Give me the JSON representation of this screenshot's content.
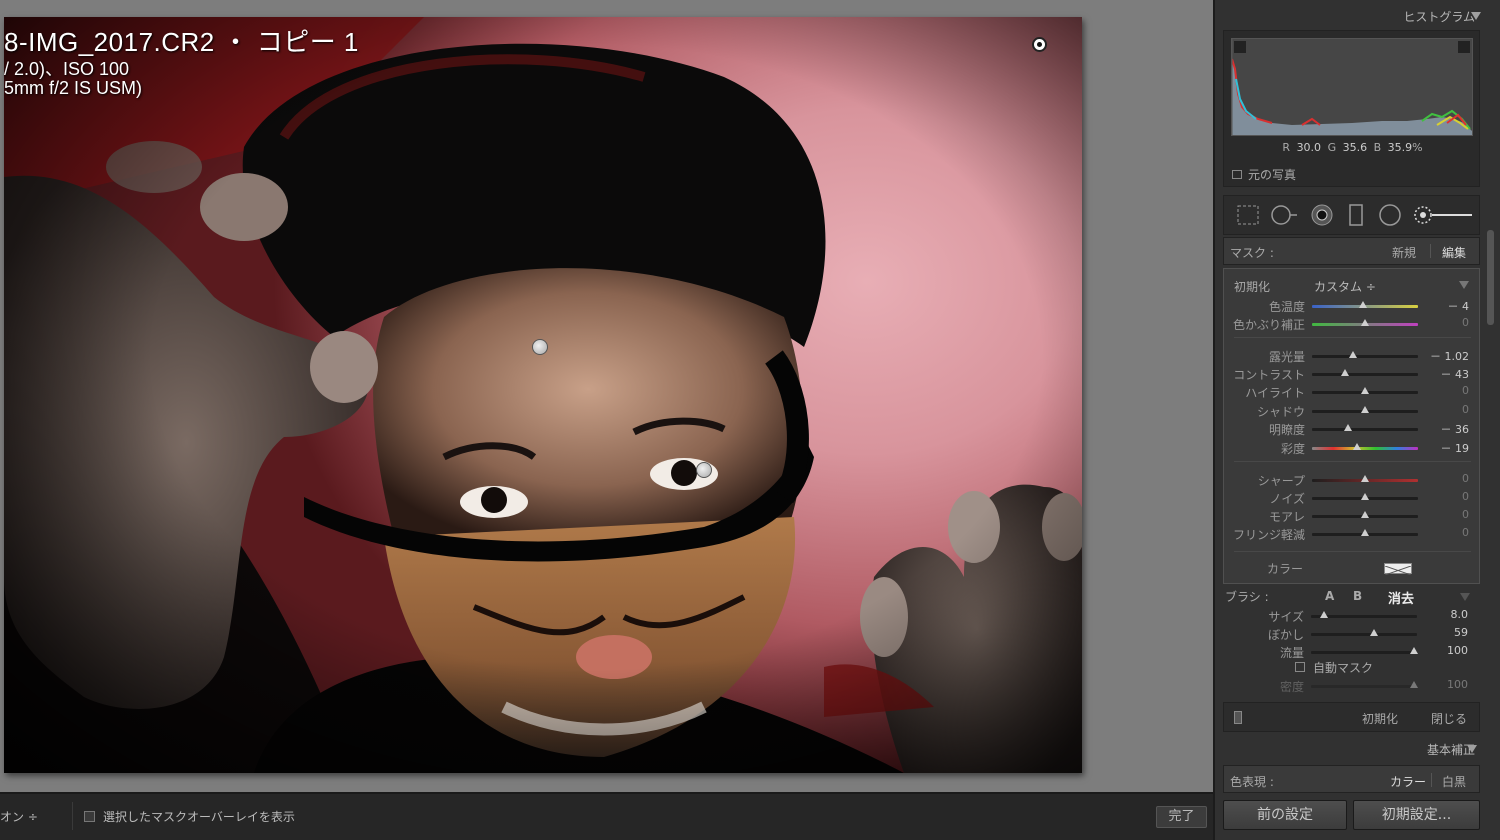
{
  "photo_info": {
    "title": "8-IMG_2017.CR2 ・ コピー 1",
    "exposure": "/ 2.0)、ISO 100",
    "lens": "5mm f/2 IS USM)"
  },
  "toolbar": {
    "left_partial": "オン ÷",
    "overlay_label": "選択したマスクオーバーレイを表示",
    "done": "完了"
  },
  "histogram": {
    "header": "ヒストグラム",
    "r_label": "R",
    "r_value": "30.0",
    "g_label": "G",
    "g_value": "35.6",
    "b_label": "B",
    "b_value": "35.9",
    "percent": "%",
    "original_photo": "元の写真"
  },
  "tools": [
    "crop-overlay-icon",
    "spot-removal-icon",
    "red-eye-icon",
    "graduated-filter-icon",
    "radial-filter-icon",
    "adjustment-brush-icon"
  ],
  "mask": {
    "label": "マスク :",
    "new": "新規",
    "edit": "編集"
  },
  "adjust": {
    "effect_label": "初期化",
    "effect_value": "カスタム ÷",
    "wb": [
      {
        "label": "色温度",
        "value": "－ 4",
        "pos": 0.48,
        "track": "temp"
      },
      {
        "label": "色かぶり補正",
        "value": "0",
        "pos": 0.5,
        "track": "tint"
      }
    ],
    "tone": [
      {
        "label": "露光量",
        "value": "－ 1.02",
        "pos": 0.39
      },
      {
        "label": "コントラスト",
        "value": "－ 43",
        "pos": 0.31
      },
      {
        "label": "ハイライト",
        "value": "0",
        "pos": 0.5
      },
      {
        "label": "シャドウ",
        "value": "0",
        "pos": 0.5
      },
      {
        "label": "明瞭度",
        "value": "－ 36",
        "pos": 0.34
      },
      {
        "label": "彩度",
        "value": "－ 19",
        "pos": 0.42,
        "track": "sat"
      }
    ],
    "detail": [
      {
        "label": "シャープ",
        "value": "0",
        "pos": 0.5,
        "track": "sharp"
      },
      {
        "label": "ノイズ",
        "value": "0",
        "pos": 0.5
      },
      {
        "label": "モアレ",
        "value": "0",
        "pos": 0.5
      },
      {
        "label": "フリンジ軽減",
        "value": "0",
        "pos": 0.5
      }
    ],
    "color_label": "カラー"
  },
  "brush": {
    "label": "ブラシ :",
    "tab_a": "A",
    "tab_b": "B",
    "erase": "消去",
    "rows": [
      {
        "label": "サイズ",
        "value": "8.0",
        "pos": 0.12
      },
      {
        "label": "ぼかし",
        "value": "59",
        "pos": 0.59
      },
      {
        "label": "流量",
        "value": "100",
        "pos": 0.97
      }
    ],
    "auto_mask": "自動マスク",
    "density_label": "密度",
    "density_value": "100",
    "density_pos": 0.97,
    "reset": "初期化",
    "close": "閉じる"
  },
  "basic": {
    "header": "基本補正",
    "color_label": "色表現 :",
    "color": "カラー",
    "bw": "白黒"
  },
  "buttons": {
    "previous": "前の設定",
    "default": "初期設定..."
  }
}
